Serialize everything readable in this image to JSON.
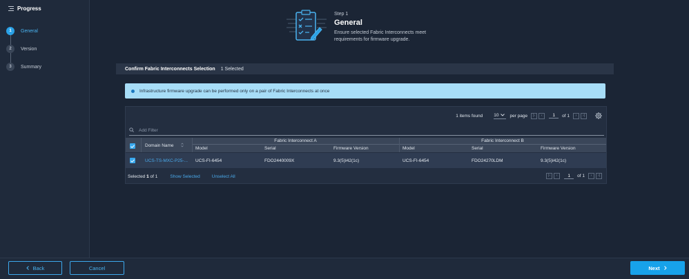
{
  "sidebar": {
    "title": "Progress",
    "steps": [
      {
        "num": "1",
        "label": "General"
      },
      {
        "num": "2",
        "label": "Version"
      },
      {
        "num": "3",
        "label": "Summary"
      }
    ]
  },
  "header": {
    "step_label": "Step 1",
    "title": "General",
    "description": "Ensure selected Fabric Interconnects meet requirements for firmware upgrade."
  },
  "selection_bar": {
    "title": "Confirm Fabric Interconnects Selection",
    "count": "1 Selected"
  },
  "info_banner": {
    "message": "Infrastructure firmware upgrade can be performed only on a pair of Fabric Interconnects at once"
  },
  "table": {
    "items_found": "1 items found",
    "per_page_value": "10",
    "per_page_label": "per page",
    "page": "1",
    "of_pages": "of 1",
    "filter_placeholder": "Add Filter",
    "group_a": "Fabric Interconnect A",
    "group_b": "Fabric Interconnect B",
    "columns": {
      "domain_name": "Domain Name",
      "model_a": "Model",
      "serial_a": "Serial",
      "firmware_a": "Firmware Version",
      "model_b": "Model",
      "serial_b": "Serial",
      "firmware_b": "Firmware Version"
    },
    "rows": [
      {
        "domain_name": "UCS-TS-MXC-P25-...",
        "model_a": "UCS-FI-6454",
        "serial_a": "FDO2440009X",
        "firmware_a": "9.3(5)I42(1c)",
        "model_b": "UCS-FI-6454",
        "serial_b": "FDO24270LDM",
        "firmware_b": "9.3(5)I42(1c)"
      }
    ],
    "footer": {
      "selected_prefix": "Selected",
      "selected_count": "1",
      "of_total": "of 1",
      "show_selected": "Show Selected",
      "unselect_all": "Unselect All",
      "page": "1",
      "of_pages": "of 1"
    }
  },
  "buttons": {
    "back": "Back",
    "cancel": "Cancel",
    "next": "Next"
  },
  "colors": {
    "accent": "#17a2ea",
    "background": "#1b2535",
    "info_banner": "#a7ddf7"
  }
}
